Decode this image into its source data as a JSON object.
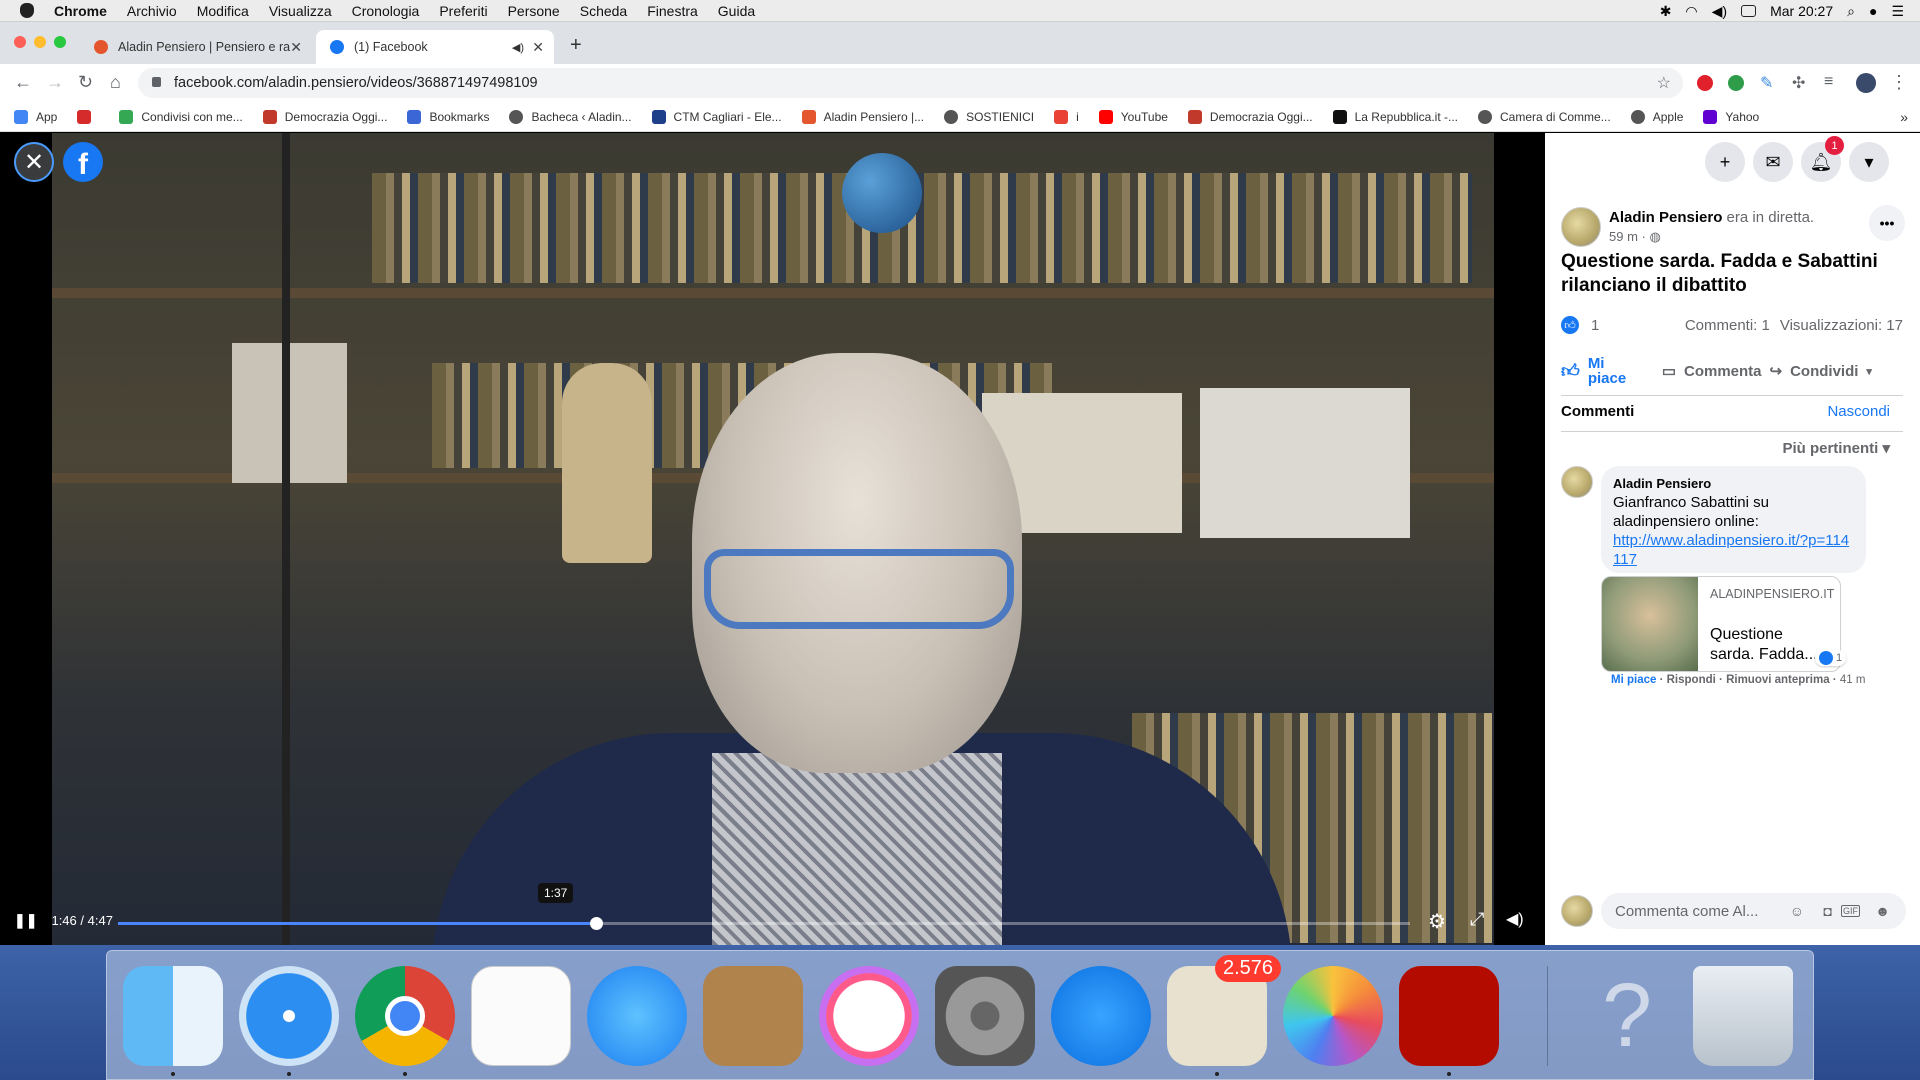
{
  "menubar": {
    "app": "Chrome",
    "items": [
      "Archivio",
      "Modifica",
      "Visualizza",
      "Cronologia",
      "Preferiti",
      "Persone",
      "Scheda",
      "Finestra",
      "Guida"
    ],
    "clock": "Mar 20:27"
  },
  "tabs": [
    {
      "title": "Aladin Pensiero | Pensiero e ra",
      "favicon_color": "#e4572e"
    },
    {
      "title": "(1) Facebook",
      "favicon_color": "#1877f2"
    }
  ],
  "toolbar": {
    "url": "facebook.com/aladin.pensiero/videos/368871497498109"
  },
  "bookmarks": [
    {
      "label": "App",
      "color": "#4285f4"
    },
    {
      "label": "Condivisi con me...",
      "color": "#34a853"
    },
    {
      "label": "Democrazia Oggi...",
      "color": "#c0392b"
    },
    {
      "label": "Bookmarks",
      "color": "#3b66d6"
    },
    {
      "label": "Bacheca ‹ Aladin...",
      "color": "#555555"
    },
    {
      "label": "CTM Cagliari - Ele...",
      "color": "#1e3f8a"
    },
    {
      "label": "Aladin Pensiero |...",
      "color": "#e4572e"
    },
    {
      "label": "SOSTIENICI",
      "color": "#555555"
    },
    {
      "label": "i",
      "color": "#ea4335"
    },
    {
      "label": "YouTube",
      "color": "#ff0000"
    },
    {
      "label": "Democrazia Oggi...",
      "color": "#c0392b"
    },
    {
      "label": "La Repubblica.it -...",
      "color": "#111111"
    },
    {
      "label": "Camera di Comme...",
      "color": "#555555"
    },
    {
      "label": "Apple",
      "color": "#555555"
    },
    {
      "label": "Yahoo",
      "color": "#6001d2"
    }
  ],
  "video": {
    "time_current": "1:46",
    "time_total": "4:47",
    "hover_time": "1:37",
    "progress": 0.37
  },
  "panel": {
    "notification_count": "1",
    "author": "Aladin Pensiero",
    "author_suffix": "era in diretta.",
    "age": "59 m",
    "title": "Questione sarda. Fadda e Sabattini rilanciano il dibattito",
    "likes": "1",
    "comments_count": "Commenti: 1",
    "views": "Visualizzazioni: 17",
    "like_label": "Mi piace",
    "comment_label": "Commenta",
    "share_label": "Condividi",
    "comments_heading": "Commenti",
    "hide_label": "Nascondi",
    "sort_label": "Più pertinenti",
    "comment": {
      "author": "Aladin Pensiero",
      "text": "Gianfranco Sabattini su aladinpensiero online:",
      "link": "http://www.aladinpensiero.it/?p=114117",
      "preview_domain": "ALADINPENSIERO.IT",
      "preview_title": "Questione sarda. Fadda...",
      "preview_likes": "1",
      "action_like": "Mi piace",
      "action_reply": "Rispondi",
      "action_remove": "Rimuovi anteprima",
      "age": "41 m"
    },
    "composer_placeholder": "Commenta come Al..."
  },
  "dock": {
    "mail_badge": "2.576",
    "apps": [
      "finder-icon",
      "safari-icon",
      "chrome-icon",
      "reminders-icon",
      "messages-icon",
      "contacts-icon",
      "itunes-icon",
      "system-preferences-icon",
      "app-store-icon",
      "mail-icon",
      "photos-icon",
      "acrobat-icon",
      "help-icon",
      "trash-icon"
    ]
  }
}
